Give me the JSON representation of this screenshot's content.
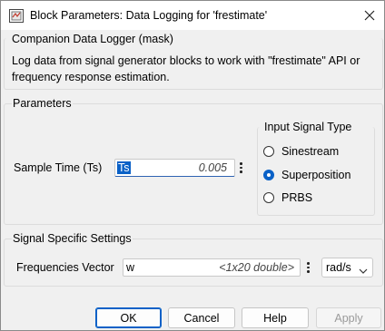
{
  "window": {
    "title": "Block Parameters: Data Logging for 'frestimate'"
  },
  "mask": {
    "group_title": "Companion Data Logger (mask)",
    "description": "Log data from signal generator blocks to work with \"frestimate\" API or frequency response estimation."
  },
  "parameters": {
    "group_title": "Parameters",
    "sample_time": {
      "label": "Sample Time (Ts)",
      "value": "Ts",
      "evaluated": "0.005"
    },
    "input_signal_type": {
      "title": "Input Signal Type",
      "options": [
        {
          "label": "Sinestream",
          "selected": false
        },
        {
          "label": "Superposition",
          "selected": true
        },
        {
          "label": "PRBS",
          "selected": false
        }
      ]
    }
  },
  "signal_specific": {
    "group_title": "Signal Specific Settings",
    "frequencies": {
      "label": "Frequencies Vector",
      "value": "w",
      "evaluated": "<1x20 double>",
      "unit": "rad/s"
    }
  },
  "buttons": {
    "ok": "OK",
    "cancel": "Cancel",
    "help": "Help",
    "apply": "Apply"
  },
  "colors": {
    "accent": "#0a61c7",
    "background": "#f0f0f0"
  },
  "icons": [
    "simulink-block-icon",
    "close-icon",
    "kebab-menu-icon",
    "chevron-down-icon"
  ]
}
